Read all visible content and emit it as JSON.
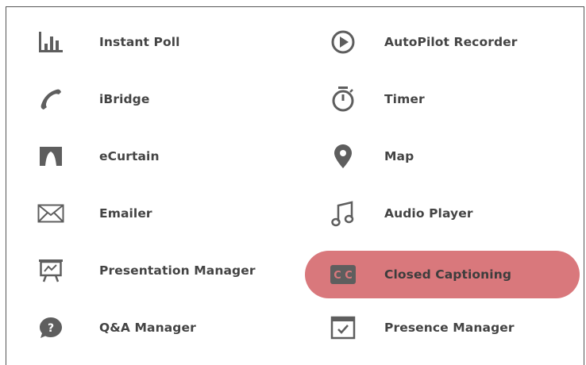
{
  "colors": {
    "icon": "#5e5e5e",
    "text": "#444444",
    "highlight": "#d9787c",
    "border": "#555555"
  },
  "left_column": [
    {
      "label": "Instant Poll",
      "icon": "bar-chart-icon"
    },
    {
      "label": "iBridge",
      "icon": "phone-handset-icon"
    },
    {
      "label": "eCurtain",
      "icon": "curtain-icon"
    },
    {
      "label": "Emailer",
      "icon": "envelope-icon"
    },
    {
      "label": "Presentation Manager",
      "icon": "presentation-easel-icon"
    },
    {
      "label": "Q&A Manager",
      "icon": "question-bubble-icon"
    }
  ],
  "right_column": [
    {
      "label": "AutoPilot Recorder",
      "icon": "play-circle-icon"
    },
    {
      "label": "Timer",
      "icon": "stopwatch-icon"
    },
    {
      "label": "Map",
      "icon": "map-pin-icon"
    },
    {
      "label": "Audio Player",
      "icon": "music-note-icon"
    },
    {
      "label": "Closed Captioning",
      "icon": "cc-icon",
      "selected": true
    },
    {
      "label": "Presence Manager",
      "icon": "calendar-check-icon"
    }
  ]
}
